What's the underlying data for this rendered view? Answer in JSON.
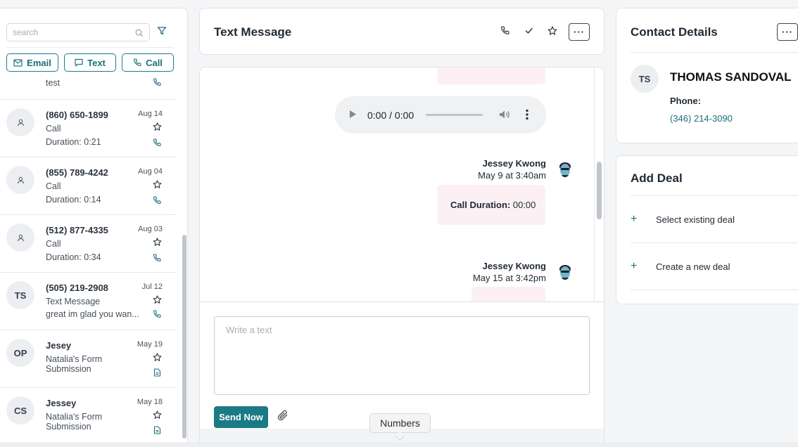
{
  "sidebar": {
    "search_placeholder": "search",
    "buttons": {
      "email": "Email",
      "text": "Text",
      "call": "Call"
    },
    "partial_item": {
      "line": "test"
    },
    "items": [
      {
        "avatar": "",
        "name": "(860) 650-1899",
        "date": "Aug 14",
        "line1": "Call",
        "line2": "Duration: 0:21",
        "icon": "phone-icon"
      },
      {
        "avatar": "",
        "name": "(855) 789-4242",
        "date": "Aug 04",
        "line1": "Call",
        "line2": "Duration: 0:14",
        "icon": "phone-icon"
      },
      {
        "avatar": "",
        "name": "(512) 877-4335",
        "date": "Aug 03",
        "line1": "Call",
        "line2": "Duration: 0:34",
        "icon": "phone-icon"
      },
      {
        "avatar": "TS",
        "name": "(505) 219-2908",
        "date": "Jul 12",
        "line1": "Text Message",
        "line2": "great im glad you wan...",
        "icon": "phone-icon"
      },
      {
        "avatar": "OP",
        "name": "Jesey",
        "date": "May 19",
        "line1": "Natalia's Form",
        "line2": "Submission",
        "icon": "document-icon"
      },
      {
        "avatar": "CS",
        "name": "Jessey",
        "date": "May 18",
        "line1": "Natalia's Form",
        "line2": "Submission",
        "icon": "document-icon"
      }
    ]
  },
  "conversation": {
    "title": "Text Message",
    "audio": {
      "time": "0:00 / 0:00"
    },
    "messages": [
      {
        "sender": "Jessey Kwong",
        "time": "May 9 at 3:40am",
        "label": "Call Duration:",
        "value": "00:00"
      },
      {
        "sender": "Jessey Kwong",
        "time": "May 15 at 3:42pm"
      }
    ],
    "compose_placeholder": "Write a text",
    "send_label": "Send Now",
    "tooltip": "Numbers"
  },
  "contact": {
    "title": "Contact Details",
    "initials": "TS",
    "name": "THOMAS SANDOVAL",
    "phone_label": "Phone:",
    "phone_value": "(346) 214-3090"
  },
  "deal": {
    "title": "Add Deal",
    "options": [
      "Select existing deal",
      "Create a new deal"
    ]
  },
  "colors": {
    "accent": "#1b7a85",
    "bubble": "#fcf0f4"
  }
}
